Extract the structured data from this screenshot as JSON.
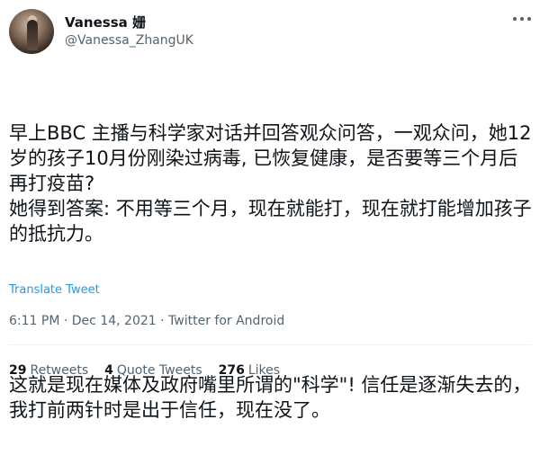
{
  "author": {
    "display_name": "Vanessa 姗",
    "handle": "@Vanessa_ZhangUK"
  },
  "icons": {
    "avatar": "user-avatar-photo",
    "more": "more-horizontal-icon"
  },
  "tweet": {
    "paragraph_1": "早上BBC 主播与科学家对话并回答观众问答，一观众问，她12岁的孩子10月份刚染过病毒, 已恢复健康，是否要等三个月后再打疫苗?\n她得到答案: 不用等三个月，现在就能打，现在就打能增加孩子的抵抗力。",
    "paragraph_2": "这就是现在媒体及政府嘴里所谓的\"科学\"! 信任是逐渐失去的，我打前两针时是出于信任，现在没了。"
  },
  "translate_label": "Translate Tweet",
  "meta": {
    "time": "6:11 PM",
    "date": "Dec 14, 2021",
    "source": "Twitter for Android",
    "separator": "·"
  },
  "stats": {
    "retweets_count": "29",
    "retweets_label": "Retweets",
    "quotes_count": "4",
    "quotes_label": "Quote Tweets",
    "likes_count": "276",
    "likes_label": "Likes"
  },
  "colors": {
    "text": "#0f1419",
    "secondary": "#536471",
    "link": "#1d9bf0",
    "divider": "#eff3f4"
  }
}
